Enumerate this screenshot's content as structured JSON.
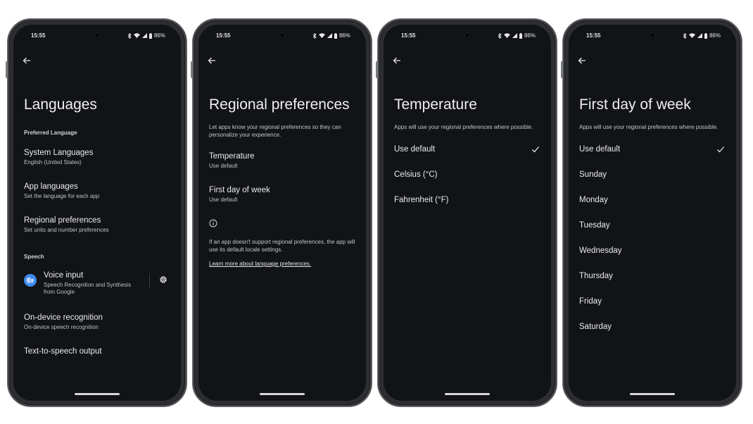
{
  "status": {
    "time": "15:55",
    "battery": "86%"
  },
  "screens": {
    "languages": {
      "title": "Languages",
      "section_preferred": "Preferred Language",
      "system_languages": {
        "label": "System Languages",
        "sub": "English (United States)"
      },
      "app_languages": {
        "label": "App languages",
        "sub": "Set the language for each app"
      },
      "regional_preferences": {
        "label": "Regional preferences",
        "sub": "Set units and number preferences"
      },
      "section_speech": "Speech",
      "voice_input": {
        "label": "Voice input",
        "sub": "Speech Recognition and Synthesis from Google"
      },
      "on_device": {
        "label": "On-device recognition",
        "sub": "On-device speech recognition"
      },
      "tts": {
        "label": "Text-to-speech output"
      }
    },
    "regional": {
      "title": "Regional preferences",
      "desc": "Let apps know your regional preferences so they can personalize your experience.",
      "temperature": {
        "label": "Temperature",
        "sub": "Use default"
      },
      "first_day": {
        "label": "First day of week",
        "sub": "Use default"
      },
      "info": "If an app doesn't support regional preferences, the app will use its default locale settings.",
      "link": "Learn more about language preferences."
    },
    "temperature": {
      "title": "Temperature",
      "desc": "Apps will use your regional preferences where possible.",
      "options": [
        "Use default",
        "Celsius (°C)",
        "Fahrenheit (°F)"
      ],
      "selected": "Use default"
    },
    "first_day": {
      "title": "First day of week",
      "desc": "Apps will use your regional preferences where possible.",
      "options": [
        "Use default",
        "Sunday",
        "Monday",
        "Tuesday",
        "Wednesday",
        "Thursday",
        "Friday",
        "Saturday"
      ],
      "selected": "Use default"
    }
  },
  "colors": {
    "screen_bg": "#111317",
    "accent_blue": "#3d8bf0"
  }
}
